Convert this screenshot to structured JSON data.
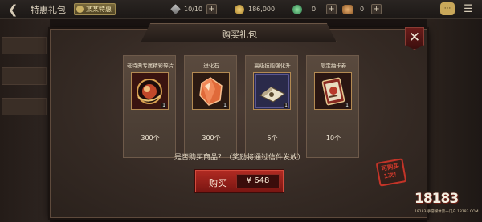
{
  "topbar": {
    "back_icon": "back-arrow-icon",
    "title": "特惠礼包",
    "tag": "某某特惠",
    "energy": "10/10",
    "gold": "186,000",
    "gems": "0",
    "bread": "0",
    "plus": "+"
  },
  "modal": {
    "title": "购买礼包",
    "close": "✕",
    "question": "是否购买商品？（奖励将通过信件发放）",
    "items": [
      {
        "name": "老特典专属精彩碎片",
        "qty": "1",
        "count": "300个",
        "icon": "orb-icon"
      },
      {
        "name": "进化石",
        "qty": "1",
        "count": "300个",
        "icon": "evolution-stone-icon"
      },
      {
        "name": "高级技能强化升",
        "qty": "1",
        "count": "5个",
        "icon": "skill-book-icon"
      },
      {
        "name": "限定抽卡券",
        "qty": "1",
        "count": "10个",
        "icon": "ticket-icon"
      }
    ],
    "buy": {
      "label": "购买",
      "price": "¥  648"
    }
  },
  "stamp": {
    "line1": "可购买",
    "line2": "1次！"
  },
  "watermark": {
    "main": "18183",
    "sub": "18183·手游媒体第一门户 18183.COM"
  },
  "colors": {
    "accent": "#b02a22",
    "card_border": "#b38a52"
  }
}
